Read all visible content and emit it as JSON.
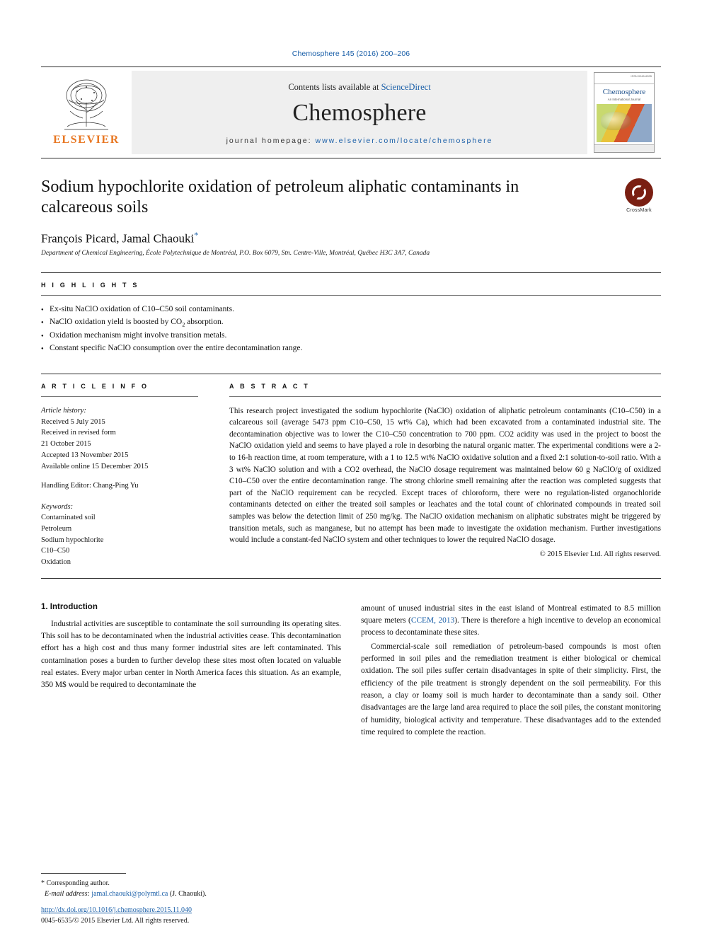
{
  "journal_ref": "Chemosphere 145 (2016) 200–206",
  "masthead": {
    "publisher": "ELSEVIER",
    "contents_prefix": "Contents lists available at ",
    "contents_link": "ScienceDirect",
    "journal_title": "Chemosphere",
    "homepage_prefix": "journal homepage: ",
    "homepage_url": "www.elsevier.com/locate/chemosphere",
    "cover": {
      "corner_note": "ISSN 0045-6535",
      "title": "Chemosphere",
      "subtitle": "An International Journal"
    }
  },
  "article": {
    "title": "Sodium hypochlorite oxidation of petroleum aliphatic contaminants in calcareous soils",
    "crossmark_label": "CrossMark",
    "authors": "François Picard, Jamal Chaouki",
    "corresponding_marker": "*",
    "affiliation": "Department of Chemical Engineering, École Polytechnique de Montréal, P.O. Box 6079, Stn. Centre-Ville, Montréal, Québec H3C 3A7, Canada"
  },
  "highlights": {
    "heading": "H I G H L I G H T S",
    "items": [
      "Ex-situ NaClO oxidation of C10–C50 soil contaminants.",
      "NaClO oxidation yield is boosted by CO2 absorption.",
      "Oxidation mechanism might involve transition metals.",
      "Constant specific NaClO consumption over the entire decontamination range."
    ]
  },
  "article_info": {
    "heading": "A R T I C L E   I N F O",
    "history_label": "Article history:",
    "history": [
      "Received 5 July 2015",
      "Received in revised form",
      "21 October 2015",
      "Accepted 13 November 2015",
      "Available online 15 December 2015"
    ],
    "handling_editor": "Handling Editor: Chang-Ping Yu",
    "keywords_label": "Keywords:",
    "keywords": [
      "Contaminated soil",
      "Petroleum",
      "Sodium hypochlorite",
      "C10–C50",
      "Oxidation"
    ]
  },
  "abstract": {
    "heading": "A B S T R A C T",
    "text": "This research project investigated the sodium hypochlorite (NaClO) oxidation of aliphatic petroleum contaminants (C10–C50) in a calcareous soil (average 5473 ppm C10–C50, 15 wt% Ca), which had been excavated from a contaminated industrial site. The decontamination objective was to lower the C10–C50 concentration to 700 ppm. CO2 acidity was used in the project to boost the NaClO oxidation yield and seems to have played a role in desorbing the natural organic matter. The experimental conditions were a 2- to 16-h reaction time, at room temperature, with a 1 to 12.5 wt% NaClO oxidative solution and a fixed 2:1 solution-to-soil ratio. With a 3 wt% NaClO solution and with a CO2 overhead, the NaClO dosage requirement was maintained below 60 g NaClO/g of oxidized C10–C50 over the entire decontamination range. The strong chlorine smell remaining after the reaction was completed suggests that part of the NaClO requirement can be recycled. Except traces of chloroform, there were no regulation-listed organochloride contaminants detected on either the treated soil samples or leachates and the total count of chlorinated compounds in treated soil samples was below the detection limit of 250 mg/kg. The NaClO oxidation mechanism on aliphatic substrates might be triggered by transition metals, such as manganese, but no attempt has been made to investigate the oxidation mechanism. Further investigations would include a constant-fed NaClO system and other techniques to lower the required NaClO dosage.",
    "copyright": "© 2015 Elsevier Ltd. All rights reserved."
  },
  "body": {
    "section_number_title": "1.  Introduction",
    "left_paragraphs": [
      "Industrial activities are susceptible to contaminate the soil surrounding its operating sites. This soil has to be decontaminated when the industrial activities cease. This decontamination effort has a high cost and thus many former industrial sites are left contaminated. This contamination poses a burden to further develop these sites most often located on valuable real estates. Every major urban center in North America faces this situation. As an example, 350 M$ would be required to decontaminate the"
    ],
    "right_paragraphs": [
      "amount of unused industrial sites in the east island of Montreal estimated to 8.5 million square meters (CCEM, 2013). There is therefore a high incentive to develop an economical process to decontaminate these sites.",
      "Commercial-scale soil remediation of petroleum-based compounds is most often performed in soil piles and the remediation treatment is either biological or chemical oxidation. The soil piles suffer certain disadvantages in spite of their simplicity. First, the efficiency of the pile treatment is strongly dependent on the soil permeability. For this reason, a clay or loamy soil is much harder to decontaminate than a sandy soil. Other disadvantages are the large land area required to place the soil piles, the constant monitoring of humidity, biological activity and temperature. These disadvantages add to the extended time required to complete the reaction."
    ],
    "citation_link": "CCEM, 2013"
  },
  "footer": {
    "corresponding_label": "* Corresponding author.",
    "email_label": "E-mail address: ",
    "email": "jamal.chaouki@polymtl.ca",
    "email_suffix": " (J. Chaouki).",
    "doi": "http://dx.doi.org/10.1016/j.chemosphere.2015.11.040",
    "issn_line": "0045-6535/© 2015 Elsevier Ltd. All rights reserved."
  },
  "colors": {
    "link": "#1a5fa8",
    "elsevier_orange": "#e87722",
    "crossmark": "#7a1f12"
  }
}
